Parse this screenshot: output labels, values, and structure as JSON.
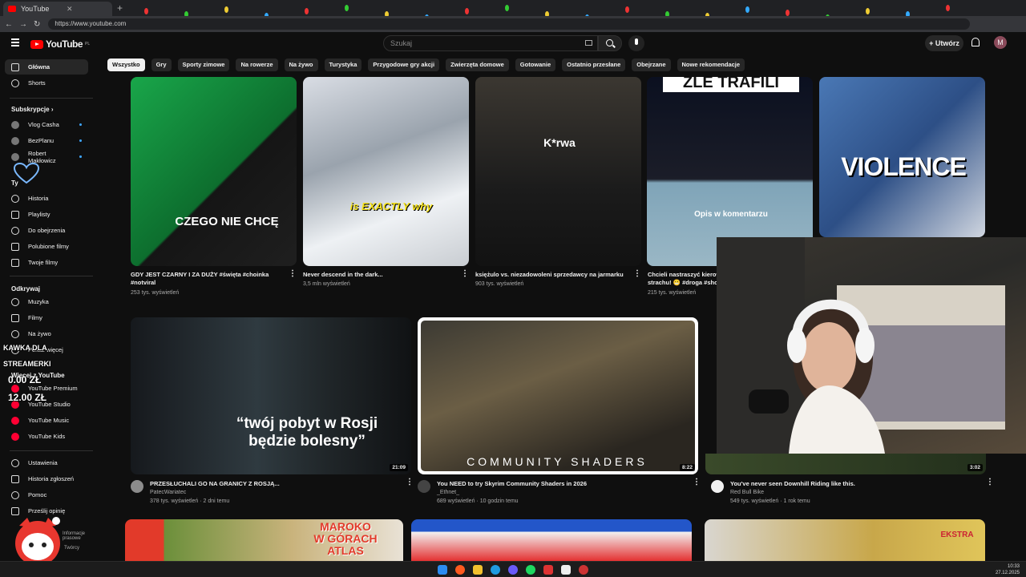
{
  "browser": {
    "tab_title": "YouTube",
    "url": "https://www.youtube.com"
  },
  "header": {
    "logo_text": "YouTube",
    "region": "PL",
    "search_placeholder": "Szukaj",
    "create_label": "Utwórz",
    "avatar_letter": "M"
  },
  "chips": [
    "Wszystko",
    "Gry",
    "Sporty zimowe",
    "Na rowerze",
    "Na żywo",
    "Turystyka",
    "Przygodowe gry akcji",
    "Zwierzęta domowe",
    "Gotowanie",
    "Ostatnio przesłane",
    "Obejrzane",
    "Nowe rekomendacje"
  ],
  "sidebar": {
    "home": "Główna",
    "shorts": "Shorts",
    "subs_header": "Subskrypcje",
    "subs": [
      "Vlog Casha",
      "BezPlanu",
      "Robert Makłowicz"
    ],
    "you_header": "Ty",
    "you_items": [
      "Historia",
      "Playlisty",
      "Do obejrzenia",
      "Polubione filmy",
      "Twoje filmy"
    ],
    "explore_header": "Odkrywaj",
    "explore_items": [
      "Muzyka",
      "Filmy",
      "Na żywo"
    ],
    "show_more": "Pokaż więcej",
    "more_header": "Więcej z YouTube",
    "more_items": [
      "YouTube Premium",
      "YouTube Studio",
      "YouTube Music",
      "YouTube Kids"
    ],
    "settings_items": [
      "Ustawienia",
      "Historia zgłoszeń",
      "Pomoc",
      "Prześlij opinię"
    ],
    "footer": [
      "Informacje prasowe",
      "Twórcy"
    ]
  },
  "overlay": {
    "donation_title_1": "KAWKA DLA",
    "donation_title_2": "STREAMERKI",
    "amount_1": "0.00 ZŁ",
    "amount_2": "12.00 ZŁ"
  },
  "row1": [
    {
      "title": "GDY JEST CZARNY I ZA DUŻY #święta #choinka",
      "title2": "#notviral",
      "meta": "253 tys. wyświetleń",
      "thumb_text": "CZEGO NIE CHCĘ"
    },
    {
      "title": "Never descend in the dark...",
      "meta": "3,5 mln wyświetleń",
      "thumb_text": "is EXACTLY why"
    },
    {
      "title": "księżulo vs. niezadowoleni sprzedawcy na jarmarku",
      "meta": "903 tys. wyświetleń",
      "thumb_text": "K*rwa"
    },
    {
      "title": "Chcieli nastraszyć kierow",
      "title2": "strachu! 😬 #droga #sho",
      "meta": "215 tys. wyświetleń",
      "thumb_text": "ZLE TRAFILI",
      "thumb_text2": "Opis w komentarzu"
    },
    {
      "thumb_text": "VIOLENCE"
    }
  ],
  "row2": [
    {
      "title": "PRZESŁUCHALI GO NA GRANICY Z ROSJĄ...",
      "channel": "PatecWariatec",
      "meta": "378 tys. wyświetleń · 2 dni temu",
      "duration": "21:09",
      "thumb_text": "“twój pobyt w Rosji",
      "thumb_text2": "będzie bolesny”"
    },
    {
      "title": "You NEED to try Skyrim Community Shaders in 2026",
      "channel": "_Ethnet_",
      "meta": "689 wyświetleń · 10 godzin temu",
      "duration": "8:22",
      "thumb_text": "COMMUNITY SHADERS"
    },
    {
      "title": "You've never seen Downhill Riding like this.",
      "channel": "Red Bull Bike",
      "meta": "549 tys. wyświetleń · 1 rok temu",
      "duration": "3:02"
    }
  ],
  "row3": [
    {
      "thumb_text": "MAROKO",
      "thumb_text2": "W GÓRACH",
      "thumb_text3": "ATLAS"
    },
    {},
    {
      "thumb_text": "EKSTRA"
    }
  ],
  "taskbar": {
    "time": "10:33",
    "date": "27.12.2025"
  }
}
